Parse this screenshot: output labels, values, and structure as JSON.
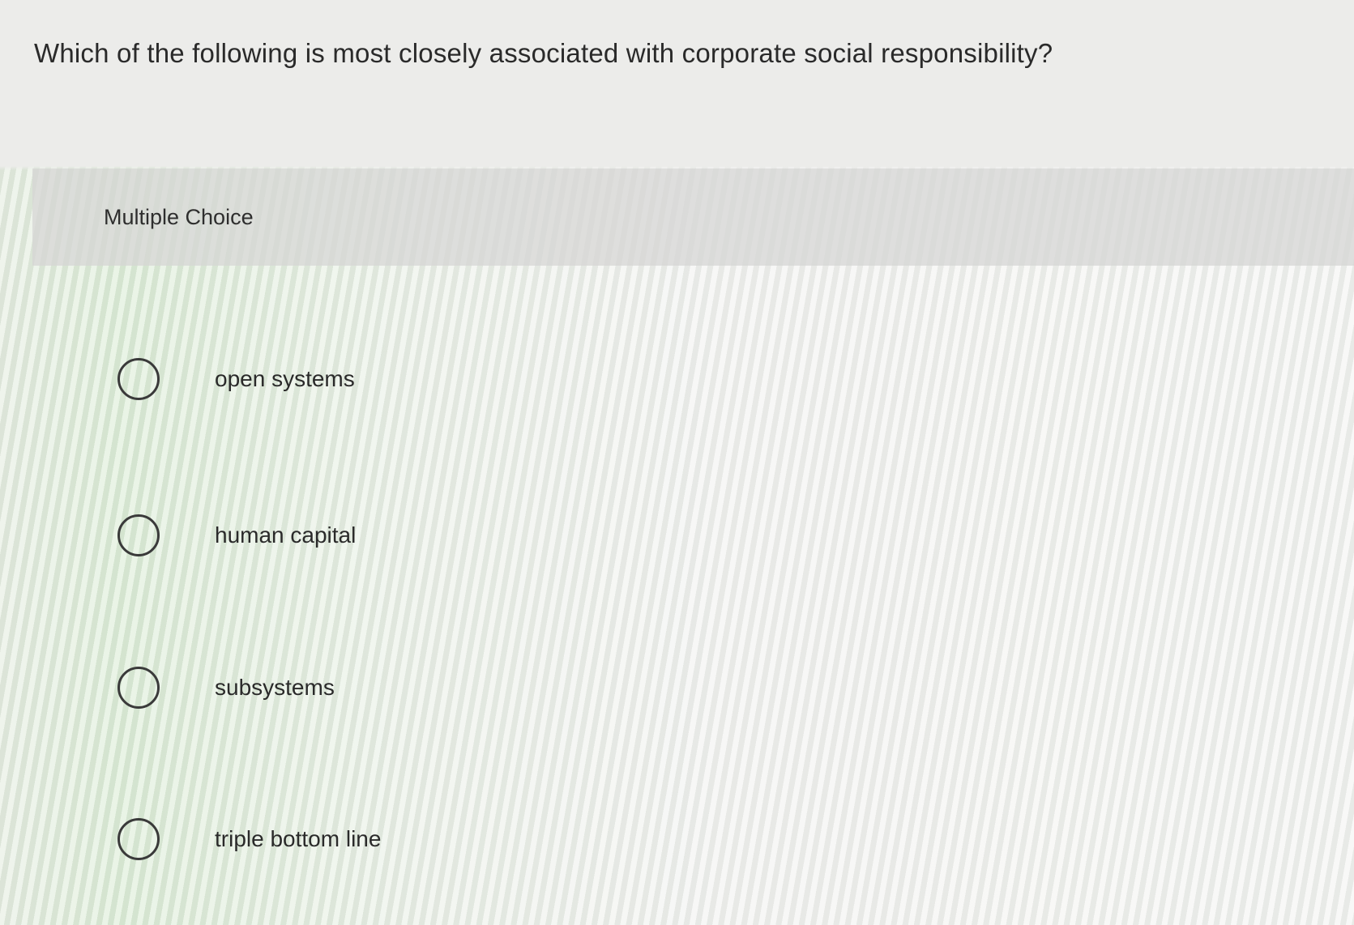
{
  "question": {
    "text": "Which of the following is most closely associated with corporate social responsibility?"
  },
  "answer_section": {
    "type_label": "Multiple Choice",
    "choices": [
      {
        "label": "open systems",
        "selected": false
      },
      {
        "label": "human capital",
        "selected": false
      },
      {
        "label": "subsystems",
        "selected": false
      },
      {
        "label": "triple bottom line",
        "selected": false
      }
    ]
  }
}
